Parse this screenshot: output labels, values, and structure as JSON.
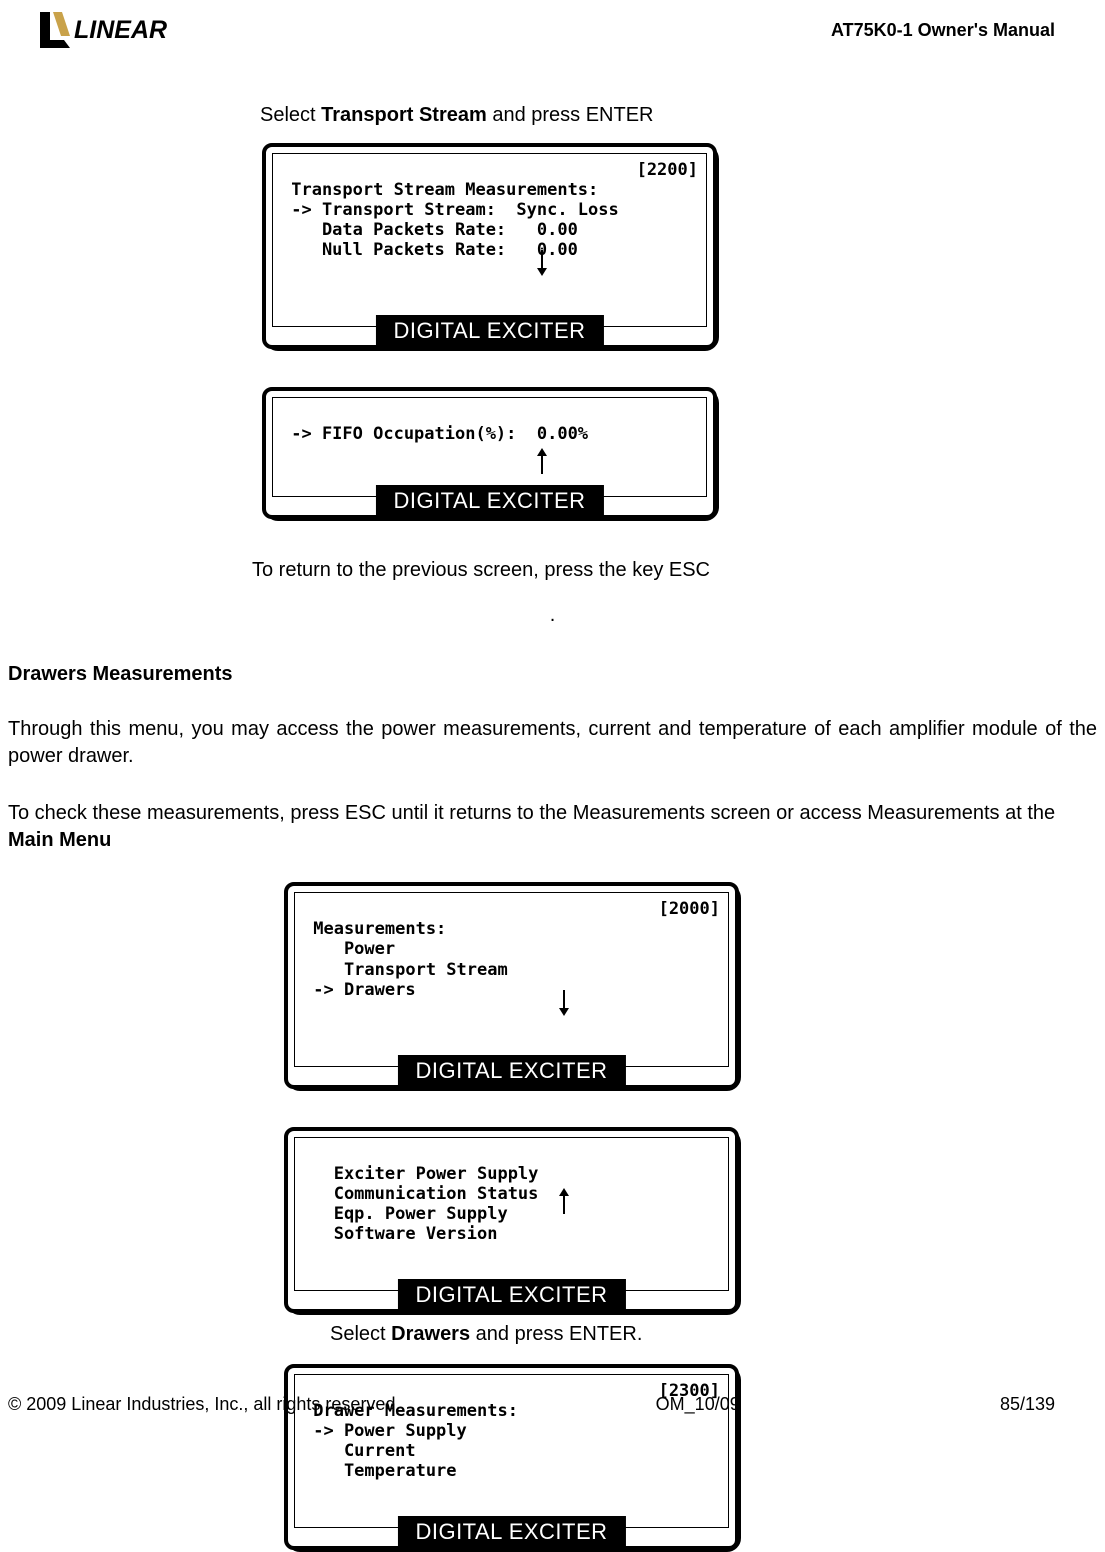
{
  "header": {
    "brand_text": "LINEAR",
    "doc_title": "AT75K0-1 Owner's Manual"
  },
  "instructions": {
    "select_transport": {
      "pre": "Select ",
      "bold": "Transport Stream",
      "post": " and press ENTER"
    },
    "return_esc": "To return to the previous screen, press the key ESC",
    "period": ".",
    "select_drawers": {
      "pre": "Select ",
      "bold": "Drawers",
      "post": " and press ENTER."
    }
  },
  "section_heading": "Drawers Measurements",
  "paragraphs": {
    "p1": "Through this menu, you may access the power measurements, current and temperature of each amplifier module of the power drawer.",
    "p2_pre": "To check these measurements, press ESC until it returns to the Measurements screen or access Measurements at the ",
    "p2_bold": "Main Menu"
  },
  "lcd_badge": "DIGITAL EXCITER",
  "panels": {
    "transport_stream": {
      "code": "[2200]",
      "lines": " Transport Stream Measurements:\n -> Transport Stream:  Sync. Loss\n    Data Packets Rate:   0.00\n    Null Packets Rate:   0.00",
      "arrow": "down"
    },
    "fifo": {
      "lines": " -> FIFO Occupation(%):  0.00%",
      "arrow": "up"
    },
    "measurements": {
      "code": "[2000]",
      "lines": " Measurements:\n    Power\n    Transport Stream\n -> Drawers",
      "arrow": "down"
    },
    "exciter_list": {
      "lines": "   Exciter Power Supply\n   Communication Status\n   Eqp. Power Supply\n   Software Version",
      "arrow": "up"
    },
    "drawer_meas": {
      "code": "[2300]",
      "lines": " Drawer Measurements:\n -> Power Supply\n    Current\n    Temperature"
    }
  },
  "footer": {
    "copyright": "© 2009 Linear Industries, Inc., all rights reserved",
    "version": "OM_10/09",
    "page": "85/139"
  }
}
